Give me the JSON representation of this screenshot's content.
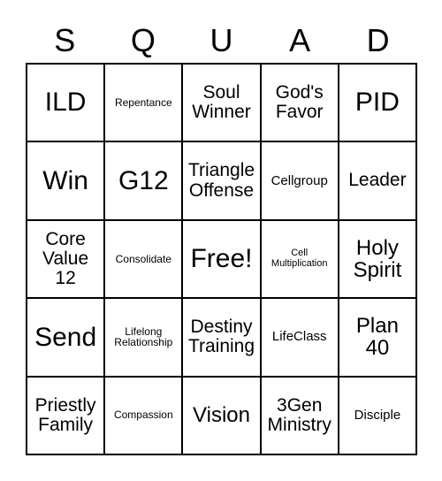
{
  "card": {
    "title_letters": [
      "S",
      "Q",
      "U",
      "A",
      "D"
    ],
    "rows": [
      [
        {
          "label": "ILD",
          "size": "xl"
        },
        {
          "label": "Repentance",
          "size": "xs"
        },
        {
          "label": "Soul Winner",
          "size": "md"
        },
        {
          "label": "God's Favor",
          "size": "md"
        },
        {
          "label": "PID",
          "size": "xl"
        }
      ],
      [
        {
          "label": "Win",
          "size": "xl"
        },
        {
          "label": "G12",
          "size": "xl"
        },
        {
          "label": "Triangle Offense",
          "size": "md"
        },
        {
          "label": "Cellgroup",
          "size": "sm"
        },
        {
          "label": "Leader",
          "size": "md"
        }
      ],
      [
        {
          "label": "Core Value 12",
          "size": "md"
        },
        {
          "label": "Consolidate",
          "size": "xs"
        },
        {
          "label": "Free!",
          "size": "xl"
        },
        {
          "label": "Cell Multiplication",
          "size": "xxs"
        },
        {
          "label": "Holy Spirit",
          "size": "lg"
        }
      ],
      [
        {
          "label": "Send",
          "size": "xl"
        },
        {
          "label": "Lifelong Relationship",
          "size": "xs"
        },
        {
          "label": "Destiny Training",
          "size": "md"
        },
        {
          "label": "LifeClass",
          "size": "sm"
        },
        {
          "label": "Plan 40",
          "size": "lg"
        }
      ],
      [
        {
          "label": "Priestly Family",
          "size": "md"
        },
        {
          "label": "Compassion",
          "size": "xs"
        },
        {
          "label": "Vision",
          "size": "lg"
        },
        {
          "label": "3Gen Ministry",
          "size": "md"
        },
        {
          "label": "Disciple",
          "size": "sm"
        }
      ]
    ],
    "colors": {
      "background": "#ffffff",
      "border": "#000000",
      "text": "#000000"
    }
  }
}
